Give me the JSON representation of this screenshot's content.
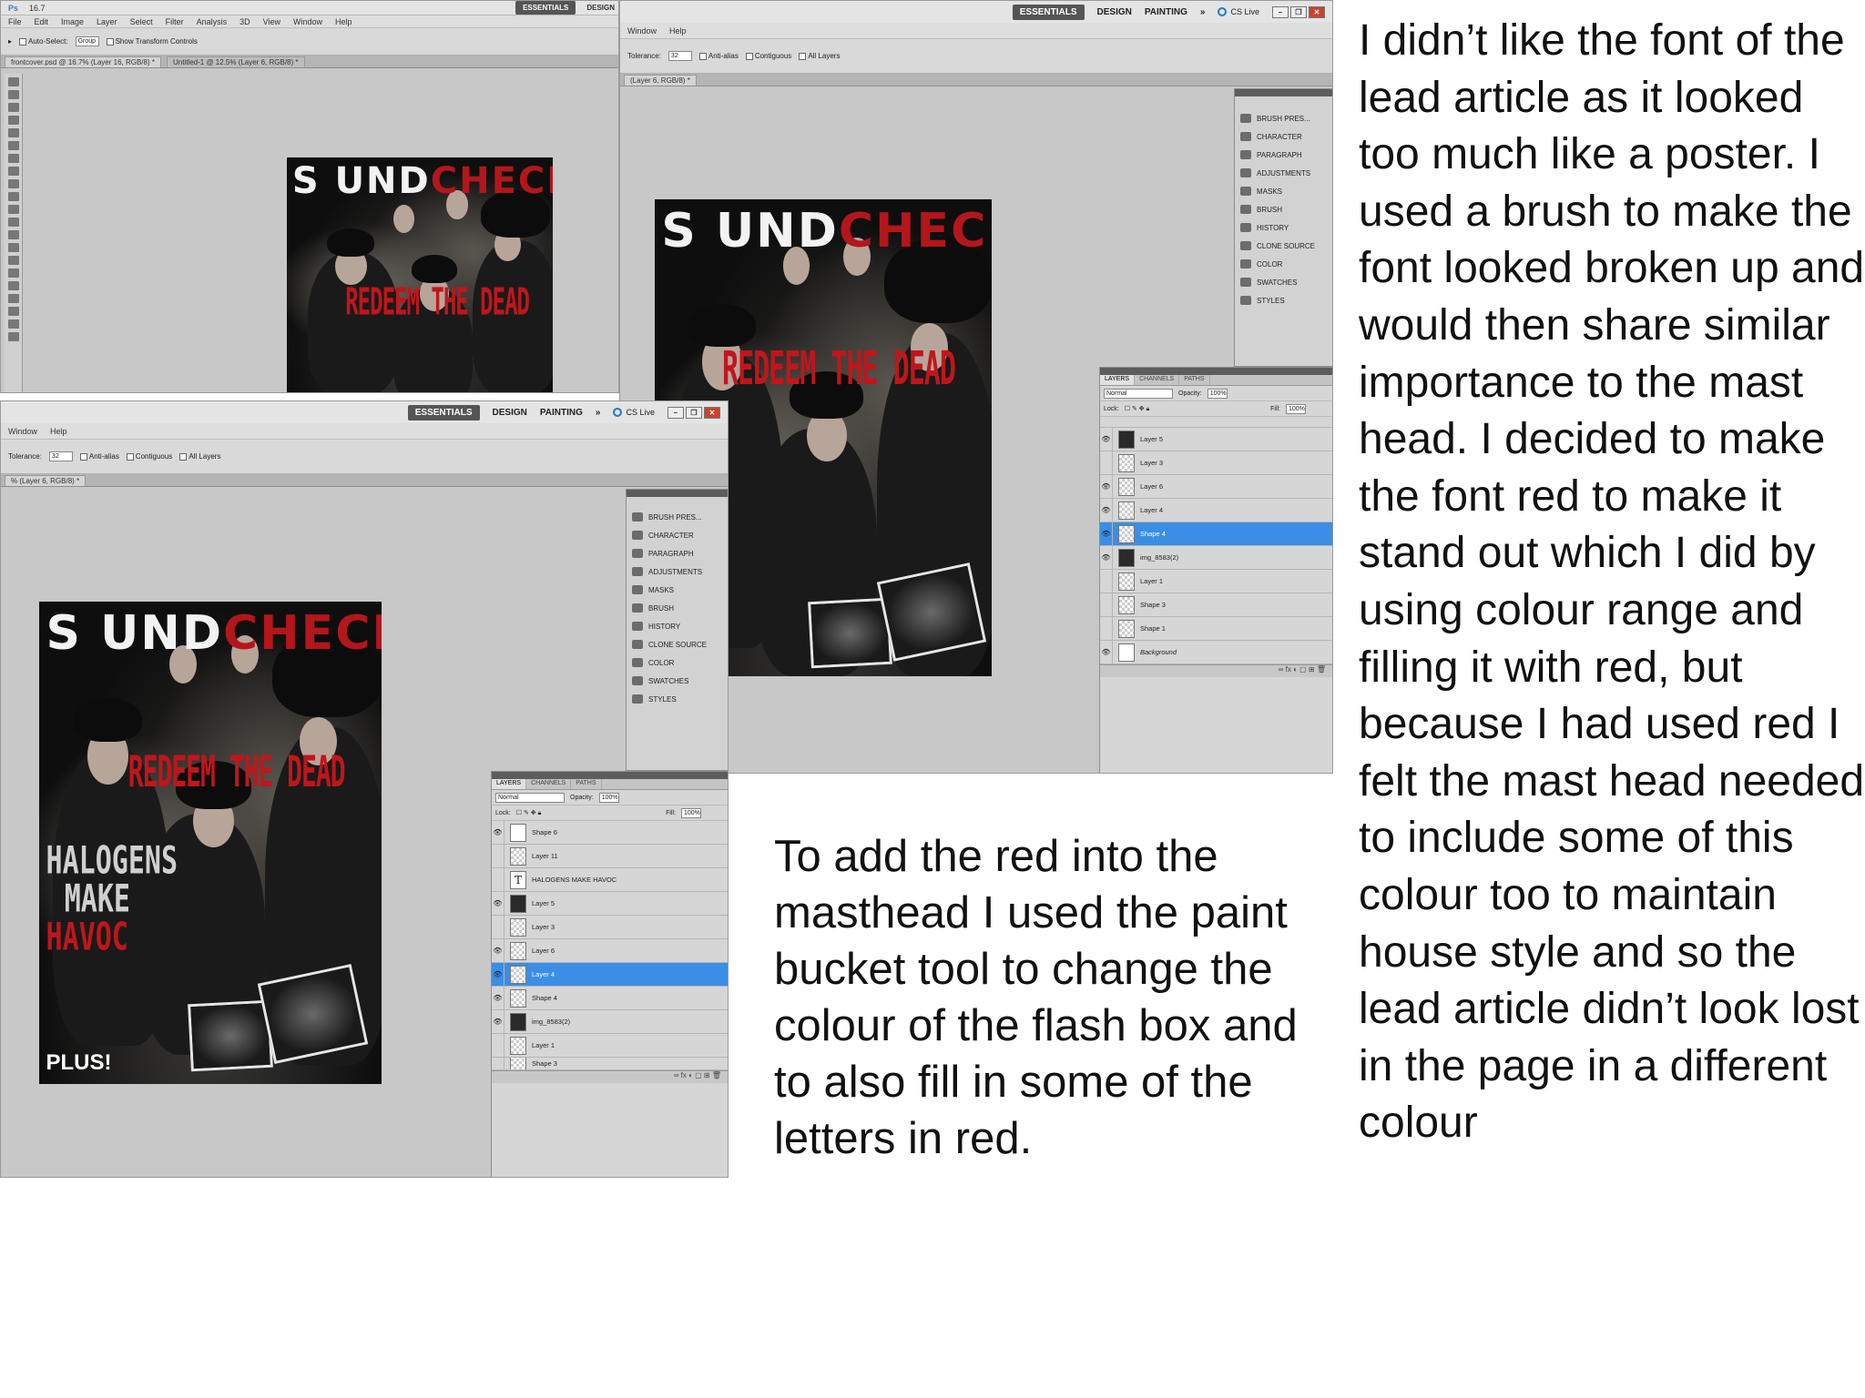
{
  "shot1": {
    "menu": [
      "File",
      "Edit",
      "Image",
      "Layer",
      "Select",
      "Filter",
      "Analysis",
      "3D",
      "View",
      "Window",
      "Help"
    ],
    "zoom": "16.7",
    "workspace_left": "ESSENTIALS",
    "workspace_right": "DESIGN",
    "options": {
      "auto_select": "Auto-Select:",
      "group": "Group",
      "transform": "Show Transform Controls"
    },
    "doc_tabs": [
      "frontcover.psd @ 16.7% (Layer 16, RGB/8) *",
      "Untitled-1 @ 12.5% (Layer 6, RGB/8) *"
    ]
  },
  "shot2": {
    "workspaces": [
      "ESSENTIALS",
      "DESIGN",
      "PAINTING"
    ],
    "more": "»",
    "cs_live": "CS Live",
    "menu": [
      "Window",
      "Help"
    ],
    "options": {
      "tolerance_label": "Tolerance:",
      "tolerance": "32",
      "anti_alias": "Anti-alias",
      "contiguous": "Contiguous",
      "all_layers": "All Layers"
    },
    "doc_tab": "(Layer 6, RGB/8) *",
    "panels": [
      "BRUSH PRES...",
      "CHARACTER",
      "PARAGRAPH",
      "ADJUSTMENTS",
      "MASKS",
      "BRUSH",
      "HISTORY",
      "CLONE SOURCE",
      "COLOR",
      "SWATCHES",
      "STYLES"
    ],
    "layer_tabs": [
      "LAYERS",
      "CHANNELS",
      "PATHS"
    ],
    "blend": "Normal",
    "opacity_label": "Opacity:",
    "opacity": "100%",
    "lock_label": "Lock:",
    "fill_label": "Fill:",
    "fill": "100%",
    "layers": [
      "Layer 5",
      "Layer 3",
      "Layer 6",
      "Layer 4",
      "Shape 4",
      "img_8583(2)",
      "Layer 1",
      "Shape 3",
      "Shape 1",
      "Background"
    ]
  },
  "shot3": {
    "workspaces": [
      "ESSENTIALS",
      "DESIGN",
      "PAINTING"
    ],
    "more": "»",
    "cs_live": "CS Live",
    "menu": [
      "Window",
      "Help"
    ],
    "options": {
      "tolerance_label": "Tolerance:",
      "tolerance": "32",
      "anti_alias": "Anti-alias",
      "contiguous": "Contiguous",
      "all_layers": "All Layers"
    },
    "doc_tab": "% (Layer 6, RGB/8) *",
    "panels": [
      "BRUSH PRES...",
      "CHARACTER",
      "PARAGRAPH",
      "ADJUSTMENTS",
      "MASKS",
      "BRUSH",
      "HISTORY",
      "CLONE SOURCE",
      "COLOR",
      "SWATCHES",
      "STYLES"
    ],
    "layer_tabs": [
      "LAYERS",
      "CHANNELS",
      "PATHS"
    ],
    "blend": "Normal",
    "opacity_label": "Opacity:",
    "opacity": "100%",
    "lock_label": "Lock:",
    "fill_label": "Fill:",
    "fill": "100%",
    "layers": [
      "Shape 6",
      "Layer 11",
      "HALOGENS MAKE HAVOC",
      "Layer 5",
      "Layer 3",
      "Layer 6",
      "Layer 4",
      "Shape 4",
      "img_8583(2)",
      "Layer 1",
      "Shape 3"
    ]
  },
  "cover": {
    "masthead_white": "S UND",
    "masthead_red": "CHECK!",
    "lead": "REDEEM THE DEAD",
    "halogens_1": "HALOGENS",
    "halogens_2": "MAKE",
    "halogens_3": "HAVOC",
    "plus": "PLUS!"
  },
  "text_middle": "To add the red into the masthead I used the paint bucket tool to change the colour of the flash box and to also fill in some of the letters in red.",
  "text_right": "I didn’t like the font of the lead article as it looked too much like a poster. I used a brush to make the font looked broken up and would then share similar importance to the mast head. I decided to make the font red to make it stand out which I did by using colour range and filling it with red, but because I had used red I felt the mast head needed to include some of this colour too to maintain house style and so the lead article didn’t look lost in the page in a different colour",
  "colors": {
    "selected_layer": "#3a8ee6",
    "accent_red": "#b3161b"
  }
}
